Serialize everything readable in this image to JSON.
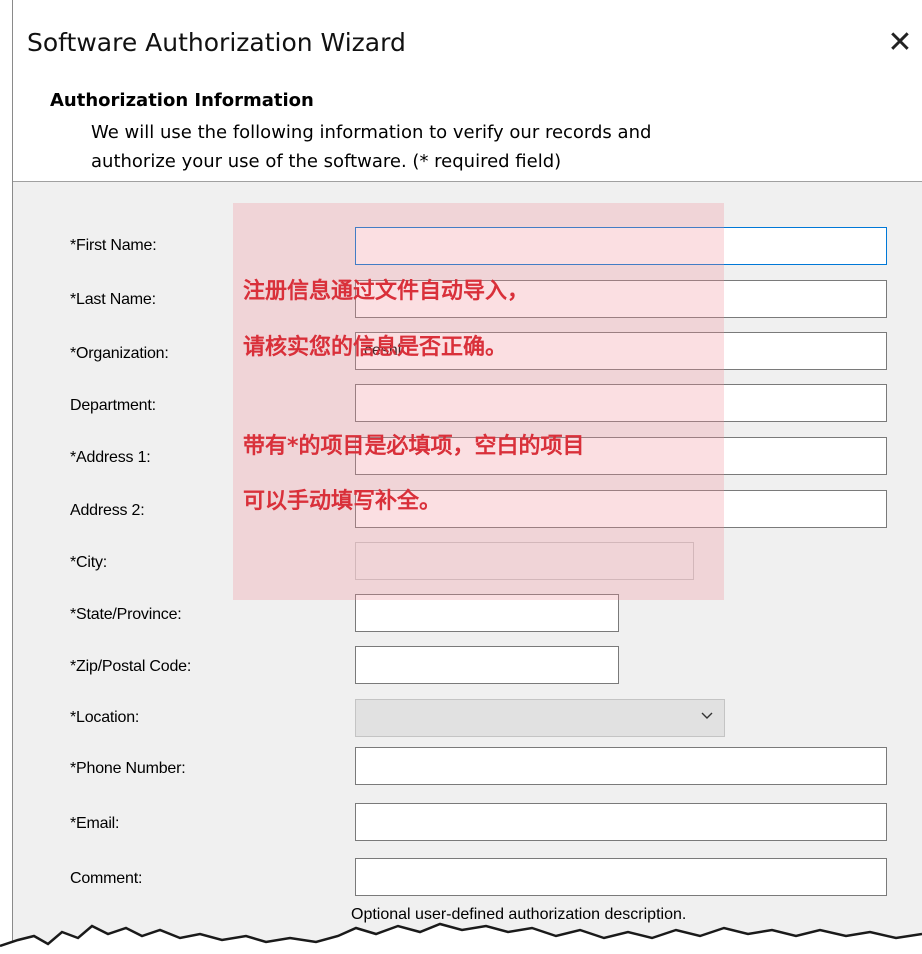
{
  "window": {
    "title": "Software Authorization Wizard",
    "close_glyph": "✕"
  },
  "header": {
    "title": "Authorization Information",
    "desc_line1": "We will use the following information to verify our records and",
    "desc_line2": "authorize your use of the software. (* required field)"
  },
  "form": {
    "first_name": {
      "label": "*First Name:",
      "value": ""
    },
    "last_name": {
      "label": "*Last Name:",
      "value": ""
    },
    "organization": {
      "label": "*Organization:",
      "value": "ceshi"
    },
    "department": {
      "label": "Department:",
      "value": ""
    },
    "address1": {
      "label": "*Address 1:",
      "value": ""
    },
    "address2": {
      "label": "Address 2:",
      "value": ""
    },
    "city": {
      "label": "*City:",
      "value": ""
    },
    "state": {
      "label": "*State/Province:",
      "value": ""
    },
    "zip": {
      "label": "*Zip/Postal Code:",
      "value": ""
    },
    "location": {
      "label": "*Location:",
      "value": ""
    },
    "phone": {
      "label": "*Phone Number:",
      "value": ""
    },
    "email": {
      "label": "*Email:",
      "value": ""
    },
    "comment": {
      "label": "Comment:",
      "value": "",
      "hint": "Optional user-defined authorization description."
    }
  },
  "annotation": {
    "line1": "注册信息通过文件自动导入，",
    "line2": "请核实您的信息是否正确。",
    "line3": "带有*的项目是必填项，空白的项目",
    "line4": "可以手动填写补全。",
    "color": "#d9303a"
  },
  "colors": {
    "focus_border": "#0078d7",
    "window_bg": "#f0f0f0"
  },
  "icons": {
    "close": "close-icon",
    "dropdown": "chevron-down-icon"
  }
}
